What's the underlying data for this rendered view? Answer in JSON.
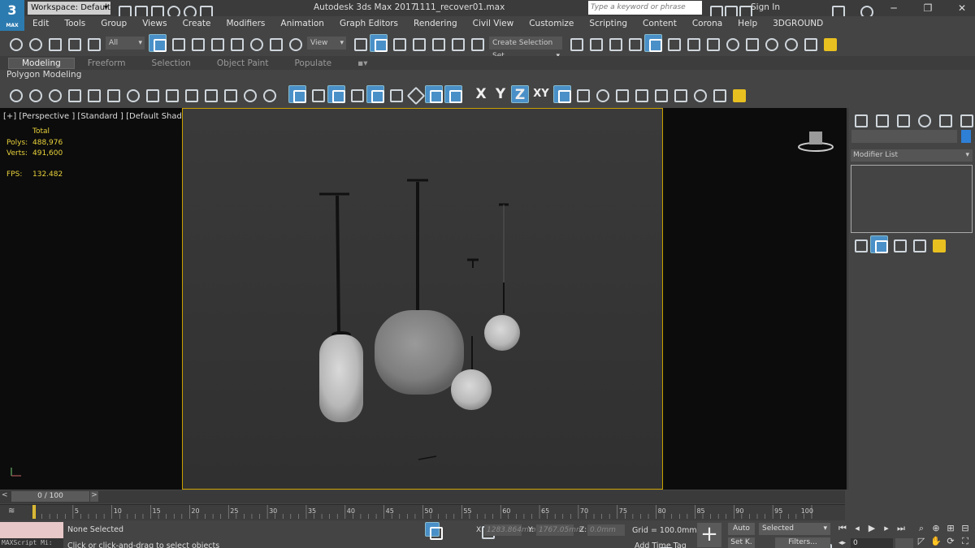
{
  "window": {
    "logo_text": "3",
    "logo_sub": "MAX",
    "workspace": "Workspace: Default",
    "app_title": "Autodesk 3ds Max 2017",
    "file_name": "1111_recover01.max",
    "search_placeholder": "Type a keyword or phrase",
    "signin": "Sign In"
  },
  "menu": [
    "Edit",
    "Tools",
    "Group",
    "Views",
    "Create",
    "Modifiers",
    "Animation",
    "Graph Editors",
    "Rendering",
    "Civil View",
    "Customize",
    "Scripting",
    "Content",
    "Corona",
    "Help",
    "3DGROUND"
  ],
  "main_toolbar": {
    "filter_dropdown": "All",
    "refcoord_dropdown": "View",
    "named_sel": "Create Selection Set"
  },
  "ribbon": {
    "tabs": [
      "Modeling",
      "Freeform",
      "Selection",
      "Object Paint",
      "Populate"
    ],
    "active_tab": "Modeling",
    "panel": "Polygon Modeling"
  },
  "constraints": [
    "X",
    "Y",
    "Z",
    "XY"
  ],
  "viewport": {
    "label": "[+] [Perspective ] [Standard ] [Default Shading ]",
    "stats_header": "Total",
    "polys_label": "Polys:",
    "polys_value": "488,976",
    "verts_label": "Verts:",
    "verts_value": "491,600",
    "fps_label": "FPS:",
    "fps_value": "132.482"
  },
  "command_panel": {
    "modifier_list": "Modifier List",
    "accent_color": "#2e7fd6"
  },
  "timeline": {
    "slider": "0 / 100",
    "ticks": [
      5,
      10,
      15,
      20,
      25,
      30,
      35,
      40,
      45,
      50,
      55,
      60,
      65,
      70,
      75,
      80,
      85,
      90,
      95,
      100
    ]
  },
  "status": {
    "maxscript": "MAXScript Mi:",
    "selection": "None Selected",
    "prompt": "Click or click-and-drag to select objects",
    "x_label": "X:",
    "x_value": "1283.864mm",
    "y_label": "Y:",
    "y_value": "1767.05mm",
    "z_label": "Z:",
    "z_value": "0.0mm",
    "grid": "Grid = 100.0mm",
    "add_time_tag": "Add Time Tag",
    "auto": "Auto",
    "set_key": "Set K.",
    "selected": "Selected",
    "filters": "Filters...",
    "frame": "0"
  }
}
